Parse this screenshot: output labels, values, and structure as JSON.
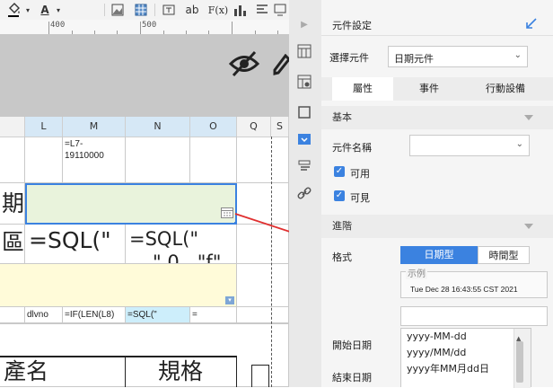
{
  "toolbar": {
    "bold_label": "B",
    "text_label": "ab",
    "fx_label": "F(x)",
    "font_color_label": "A"
  },
  "ruler": {
    "marks": [
      "400",
      "500"
    ]
  },
  "columns": [
    "L",
    "M",
    "N",
    "O",
    "Q",
    "S"
  ],
  "grid": {
    "m1": "=L7-\n19110000",
    "r2_left": "期",
    "r3_left": "區",
    "r3_m": "=SQL(\"",
    "r3_n": "=SQL(\"",
    "r3_n2": "\" 0 . \"f\"",
    "r5_l": "dlvno",
    "r5_m": "=IF(LEN(L8)",
    "r5_n": "=SQL(\"",
    "r5_o": "=",
    "r6_left": "產名",
    "r6_n": "規格"
  },
  "panel": {
    "title": "元件設定",
    "select_label": "選擇元件",
    "select_value": "日期元件",
    "tabs": [
      "屬性",
      "事件",
      "行動設備"
    ],
    "section_basic": "基本",
    "name_label": "元件名稱",
    "name_value": "",
    "available_label": "可用",
    "visible_label": "可見",
    "section_advanced": "進階",
    "format_label": "格式",
    "format_buttons": [
      "日期型",
      "時間型"
    ],
    "example_label": "示例",
    "example_value": "Tue Dec 28 16:43:55 CST 2021",
    "format_input_value": "",
    "format_options": [
      "yyyy-MM-dd",
      "yyyy/MM/dd",
      "yyyy年MM月dd日"
    ],
    "start_date_label": "開始日期",
    "end_date_label": "結束日期"
  },
  "colors": {
    "accent": "#3b82e0",
    "selected_cell_bg": "#e9f3dc",
    "yellow_row": "#fffbd9",
    "arrow": "#e03030"
  }
}
